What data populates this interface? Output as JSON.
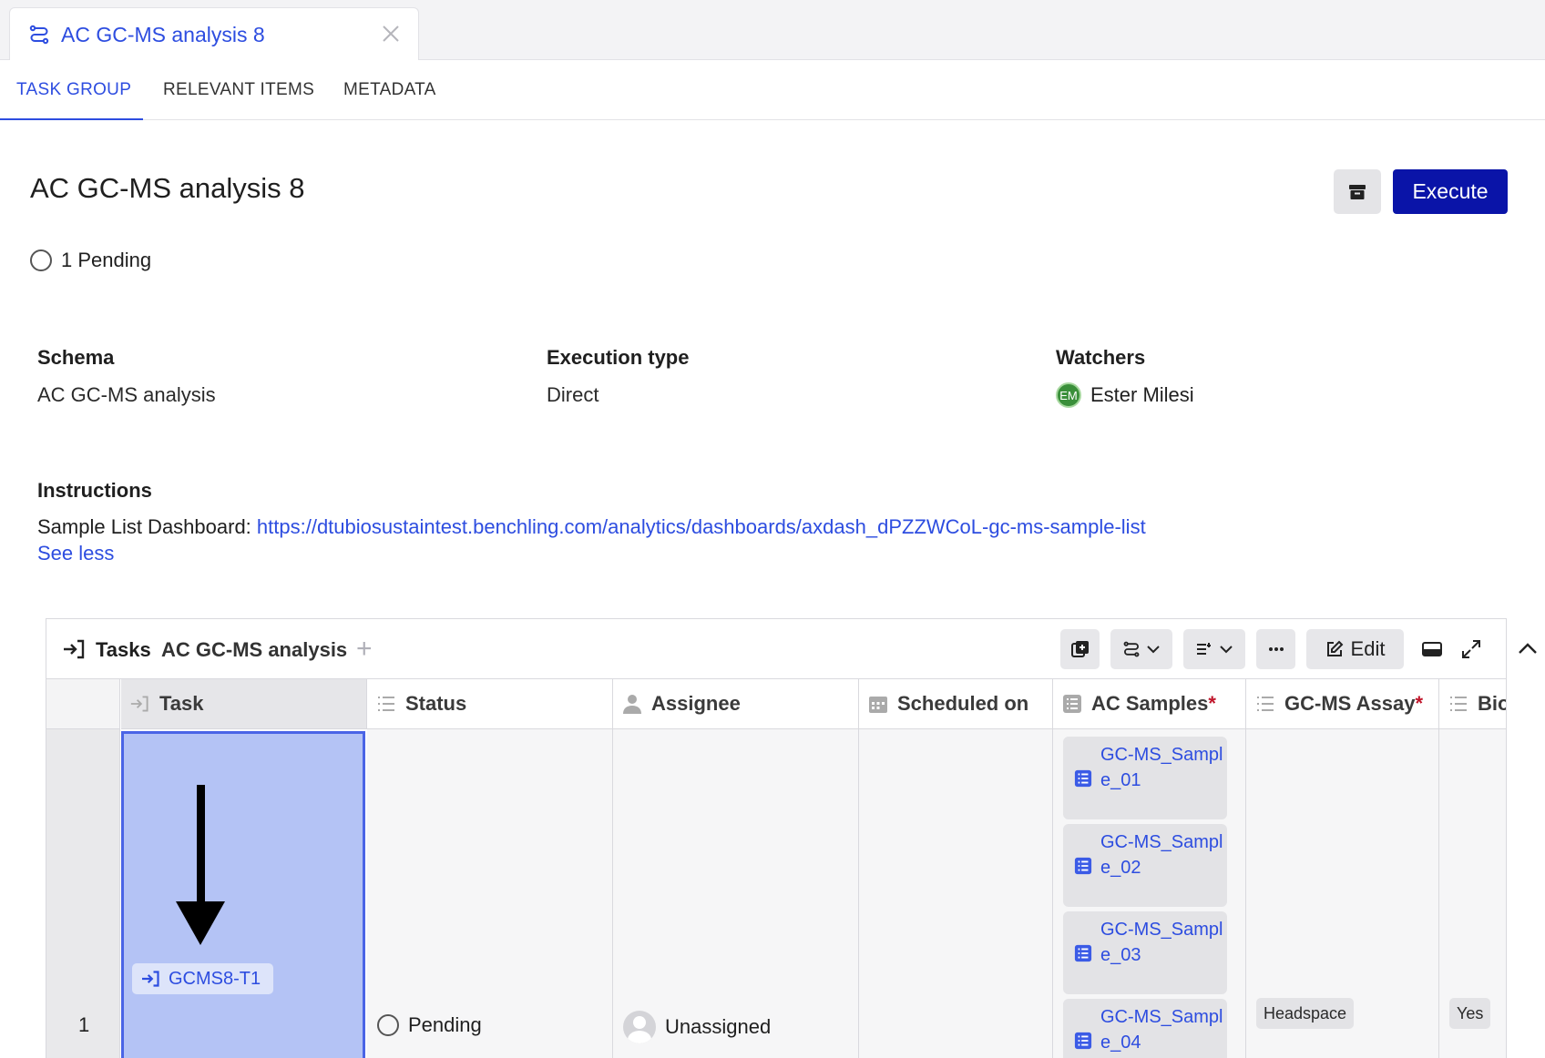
{
  "tab": {
    "title": "AC GC-MS analysis 8",
    "icon": "workflow-icon",
    "close_icon": "close-icon"
  },
  "nav": {
    "items": [
      "TASK GROUP",
      "RELEVANT ITEMS",
      "METADATA"
    ],
    "active": "TASK GROUP"
  },
  "header": {
    "title": "AC GC-MS analysis 8",
    "execute_label": "Execute",
    "archive_icon": "archive-icon"
  },
  "summary": {
    "pending": "1 Pending"
  },
  "fields": {
    "schema_label": "Schema",
    "schema_value": "AC GC-MS analysis",
    "execution_label": "Execution type",
    "execution_value": "Direct",
    "watchers_label": "Watchers",
    "watcher_initials": "EM",
    "watcher_name": "Ester Milesi"
  },
  "instructions": {
    "label": "Instructions",
    "prefix": "Sample List Dashboard: ",
    "link": "https://dtubiosustaintest.benchling.com/analytics/dashboards/axdash_dPZZWCoL-gc-ms-sample-list",
    "see_less": "See less"
  },
  "table": {
    "title": "Tasks",
    "schema": "AC GC-MS analysis",
    "edit_label": "Edit",
    "columns": [
      "Task",
      "Status",
      "Assignee",
      "Scheduled on",
      "AC Samples",
      "GC-MS Assay",
      "Bio"
    ],
    "required_mark": "*",
    "rows": [
      {
        "num": "1",
        "task": "GCMS8-T1",
        "status": "Pending",
        "assignee": "Unassigned",
        "scheduled": "",
        "samples": [
          "GC-MS_Sample_01",
          "GC-MS_Sample_02",
          "GC-MS_Sample_03",
          "GC-MS_Sample_04"
        ],
        "assay": "Headspace",
        "bio": "Yes"
      }
    ]
  },
  "colors": {
    "accent": "#2d4de0",
    "execute": "#0a14a8",
    "selection": "#b4c3f5",
    "required": "#c0152a",
    "avatar_green": "#3a8f3a"
  }
}
